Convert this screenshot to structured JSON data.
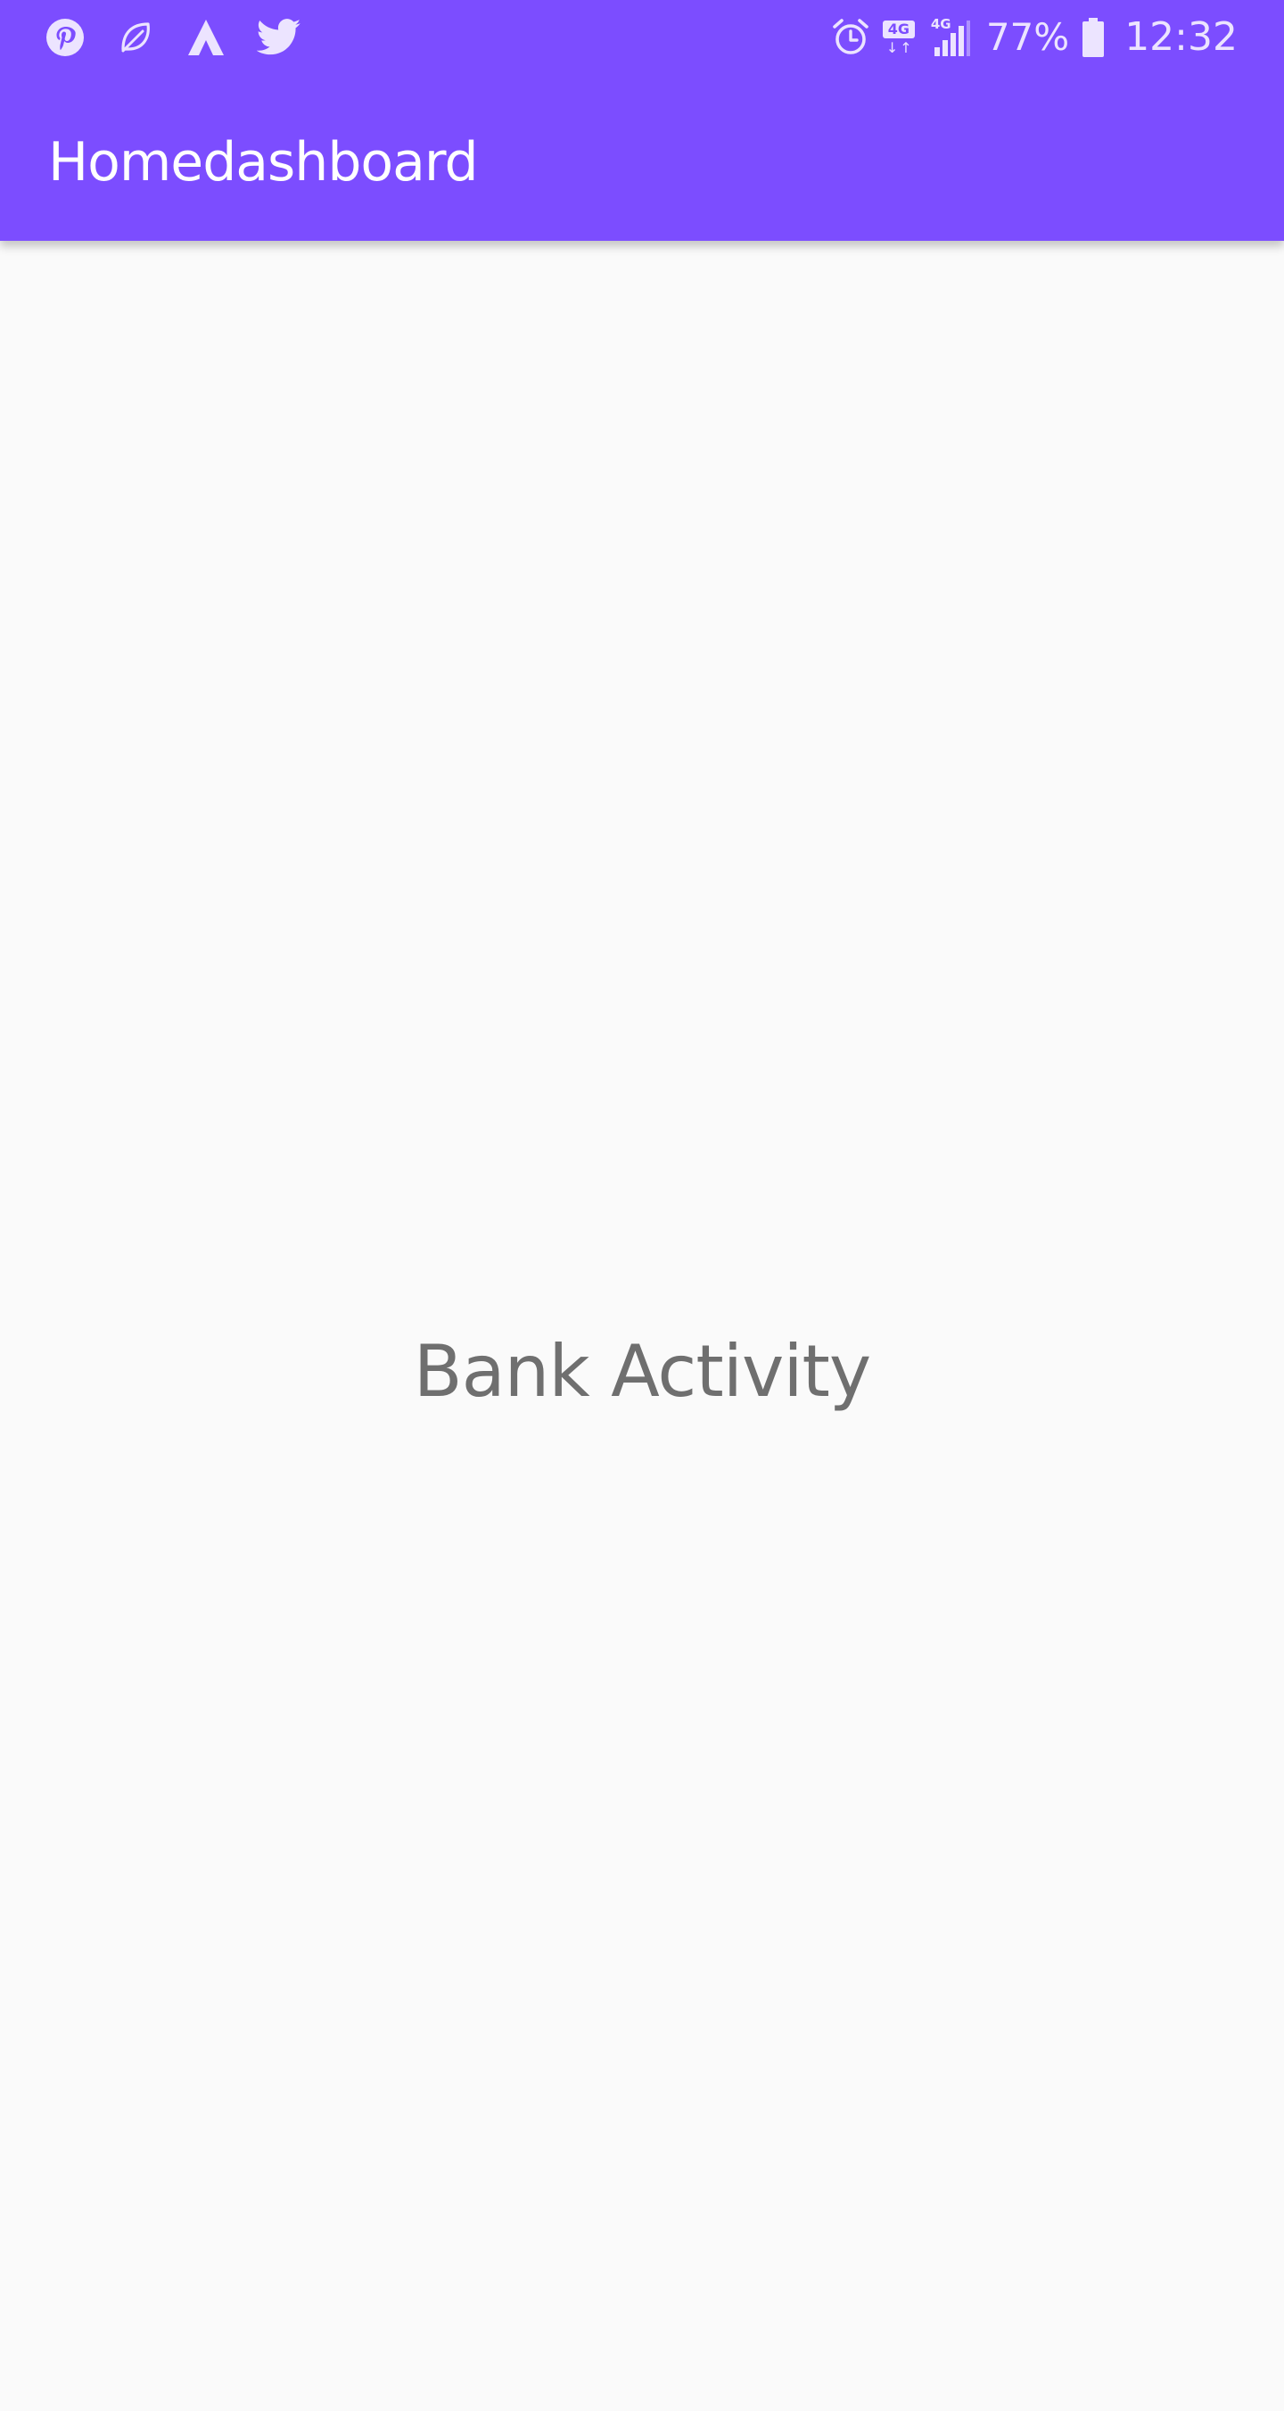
{
  "status_bar": {
    "left_icons": [
      "pinterest-icon",
      "leaf-icon",
      "arrow-a-icon",
      "twitter-icon"
    ],
    "right_icons": [
      "alarm-icon",
      "network-4g-data-icon",
      "signal-4g-icon",
      "battery-icon"
    ],
    "network_tag": "4G",
    "signal_tag": "4G",
    "battery_percent": "77%",
    "time": "12:32"
  },
  "app_bar": {
    "title": "Homedashboard"
  },
  "main": {
    "label": "Bank Activity"
  },
  "colors": {
    "primary": "#7c4dff",
    "background": "#fafafa",
    "status_icons": "#ece4ff",
    "title_text": "#ffffff",
    "body_text": "#6f6f6f"
  }
}
